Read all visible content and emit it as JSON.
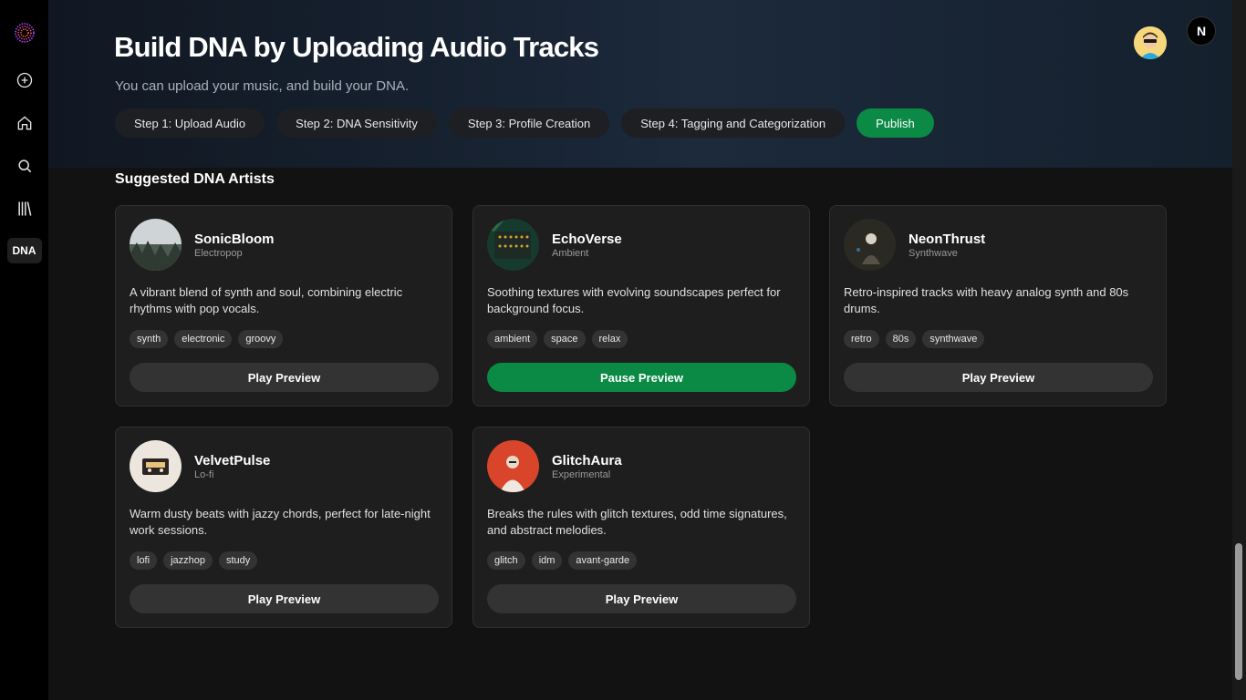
{
  "sidebar": {
    "items": [
      {
        "name": "add-icon"
      },
      {
        "name": "home-icon"
      },
      {
        "name": "search-icon"
      },
      {
        "name": "library-icon"
      }
    ],
    "dna_label": "DNA"
  },
  "header": {
    "title": "Build DNA by Uploading Audio Tracks",
    "subtitle": "You can upload your music, and build your DNA.",
    "steps": [
      "Step 1: Upload Audio",
      "Step 2: DNA Sensitivity",
      "Step 3: Profile Creation",
      "Step 4: Tagging and Categorization"
    ],
    "publish_label": "Publish",
    "n_button": "N"
  },
  "section_title": "Suggested DNA Artists",
  "artists": [
    {
      "name": "SonicBloom",
      "genre": "Electropop",
      "description": "A vibrant blend of synth and soul, combining electric rhythms with pop vocals.",
      "tags": [
        "synth",
        "electronic",
        "groovy"
      ],
      "button": "Play Preview",
      "playing": false
    },
    {
      "name": "EchoVerse",
      "genre": "Ambient",
      "description": "Soothing textures with evolving soundscapes perfect for background focus.",
      "tags": [
        "ambient",
        "space",
        "relax"
      ],
      "button": "Pause Preview",
      "playing": true
    },
    {
      "name": "NeonThrust",
      "genre": "Synthwave",
      "description": "Retro-inspired tracks with heavy analog synth and 80s drums.",
      "tags": [
        "retro",
        "80s",
        "synthwave"
      ],
      "button": "Play Preview",
      "playing": false
    },
    {
      "name": "VelvetPulse",
      "genre": "Lo-fi",
      "description": "Warm dusty beats with jazzy chords, perfect for late-night work sessions.",
      "tags": [
        "lofi",
        "jazzhop",
        "study"
      ],
      "button": "Play Preview",
      "playing": false
    },
    {
      "name": "GlitchAura",
      "genre": "Experimental",
      "description": "Breaks the rules with glitch textures, odd time signatures, and abstract melodies.",
      "tags": [
        "glitch",
        "idm",
        "avant-garde"
      ],
      "button": "Play Preview",
      "playing": false
    }
  ],
  "colors": {
    "accent": "#0a8a45",
    "background": "#121212",
    "card": "#1e1e1e"
  }
}
